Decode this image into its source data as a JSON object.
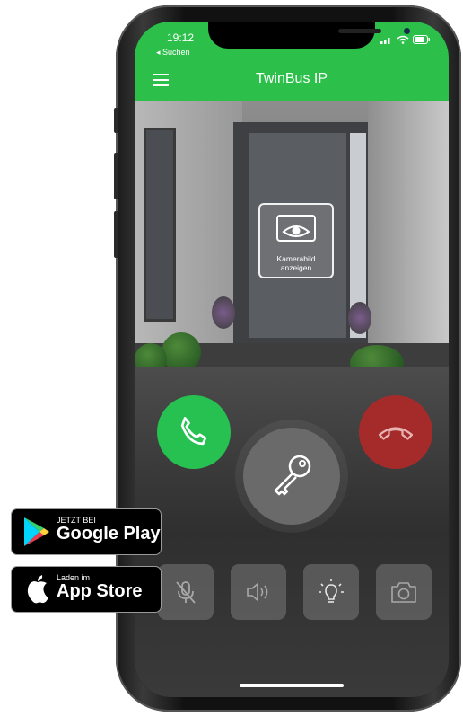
{
  "status": {
    "time": "19:12",
    "back_label": "◂ Suchen"
  },
  "header": {
    "title": "TwinBus IP"
  },
  "camera": {
    "overlay_label_line1": "Kamerabild",
    "overlay_label_line2": "anzeigen"
  },
  "actions": {
    "accept_icon": "phone-accept-icon",
    "decline_icon": "phone-hangup-icon",
    "door_open_icon": "key-icon"
  },
  "toolbar": {
    "mic_icon": "microphone-muted-icon",
    "speaker_icon": "speaker-icon",
    "light_icon": "lightbulb-icon",
    "snapshot_icon": "camera-icon"
  },
  "badges": {
    "google": {
      "small": "JETZT BEI",
      "big": "Google Play"
    },
    "apple": {
      "small": "Laden im",
      "big": "App Store"
    }
  },
  "colors": {
    "brand_green": "#2cc04b",
    "accept": "#27c152",
    "decline": "#a52b2b"
  }
}
